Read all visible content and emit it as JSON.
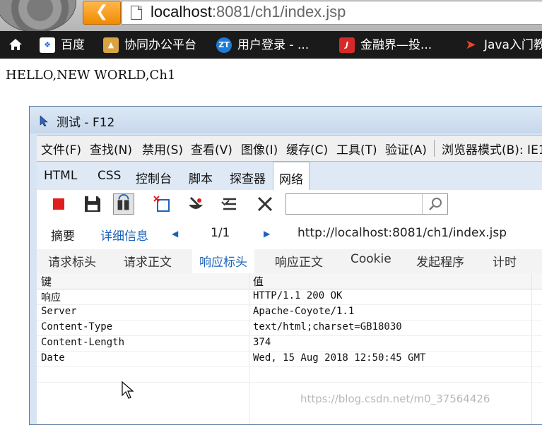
{
  "browser": {
    "url_host": "localhost",
    "url_rest": ":8081/ch1/index.jsp",
    "bookmarks": [
      {
        "label": "百度",
        "icon": "baidu-paw-icon",
        "color": "#2a6cd6"
      },
      {
        "label": "协同办公平台",
        "icon": "fox-icon",
        "color": "#d9a441"
      },
      {
        "label": "用户登录 - ...",
        "icon": "zt-logo-icon",
        "color": "#1e7bd6",
        "icon_text": "ZT"
      },
      {
        "label": "金融界—投...",
        "icon": "jrj-logo-icon",
        "color": "#d62a2a",
        "icon_text": "J"
      },
      {
        "label": "Java入门教",
        "icon": "swift-bird-icon",
        "color": "#e8452c"
      }
    ]
  },
  "page": {
    "text": "HELLO,NEW WORLD,Ch1"
  },
  "devtools": {
    "title": "测试 - F12",
    "menu": [
      "文件(F)",
      "查找(N)",
      "禁用(S)",
      "查看(V)",
      "图像(I)",
      "缓存(C)",
      "工具(T)",
      "验证(A)",
      "浏览器模式(B): IE1"
    ],
    "tabs": [
      "HTML",
      "CSS",
      "控制台",
      "脚本",
      "探查器",
      "网络"
    ],
    "active_tab": "网络",
    "nav": {
      "summary": "摘要",
      "details": "详细信息",
      "page": "1/1",
      "url": "http://localhost:8081/ch1/index.jsp"
    },
    "subtabs": [
      "请求标头",
      "请求正文",
      "响应标头",
      "响应正文",
      "Cookie",
      "发起程序",
      "计时"
    ],
    "active_subtab": "响应标头",
    "grid": {
      "headers": [
        "键",
        "值"
      ],
      "rows": [
        {
          "key": "响应",
          "value": "HTTP/1.1 200 OK"
        },
        {
          "key": "Server",
          "value": "Apache-Coyote/1.1"
        },
        {
          "key": "Content-Type",
          "value": "text/html;charset=GB18030"
        },
        {
          "key": "Content-Length",
          "value": "374"
        },
        {
          "key": "Date",
          "value": "Wed, 15 Aug 2018 12:50:45 GMT"
        }
      ]
    }
  },
  "watermark": "https://blog.csdn.net/m0_37564426",
  "colors": {
    "accent": "#1c63b7",
    "back_button": "#f08a00",
    "record_stop": "#e01e1e"
  }
}
